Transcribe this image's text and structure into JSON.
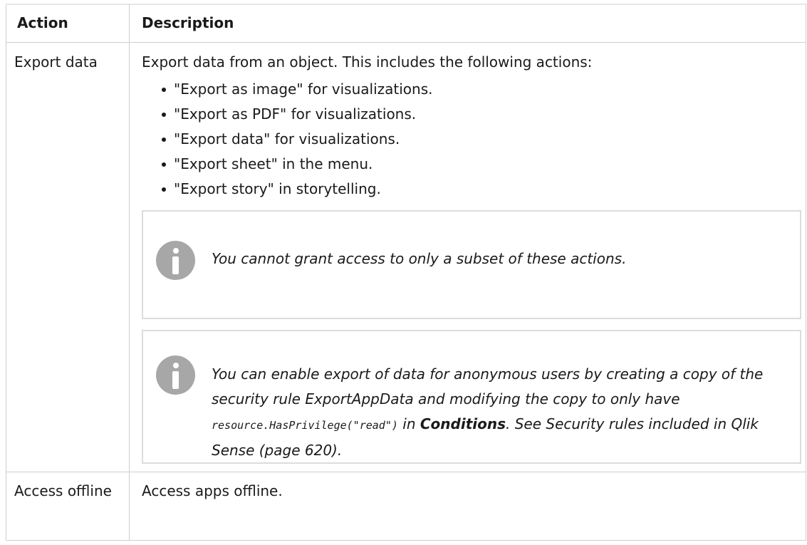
{
  "table": {
    "headers": {
      "action": "Action",
      "description": "Description"
    },
    "rows": [
      {
        "action": "Export data",
        "description_intro": "Export data from an object. This includes the following actions:",
        "bullets": [
          "\"Export as image\" for visualizations.",
          "\"Export as PDF\" for visualizations.",
          "\"Export data\" for visualizations.",
          "\"Export sheet\" in the menu.",
          "\"Export story\" in storytelling."
        ],
        "notes": [
          {
            "icon": "info-icon",
            "text": "You cannot grant access to only a subset of these actions."
          },
          {
            "icon": "info-icon",
            "text_part1": "You can enable export of data for anonymous users by creating a copy of the security rule ExportAppData and modifying the copy to only have ",
            "code": "resource.HasPrivilege(\"read\")",
            "text_part2": " in ",
            "bold": "Conditions",
            "text_part3": ". See Security rules included in Qlik Sense (page 620)."
          }
        ]
      },
      {
        "action": "Access offline",
        "description": "Access apps offline."
      }
    ]
  }
}
